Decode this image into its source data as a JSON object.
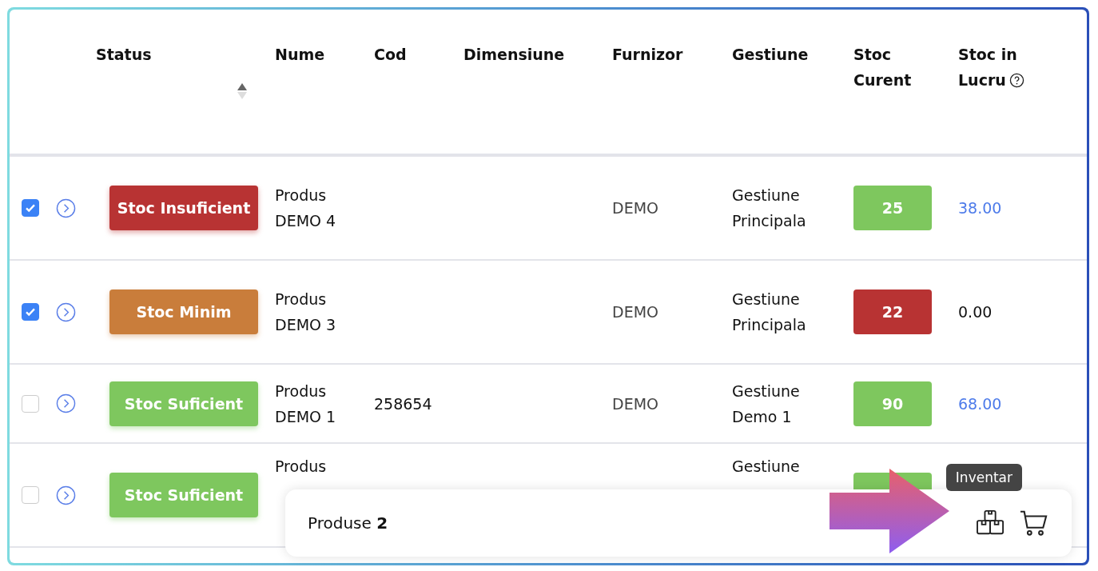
{
  "table": {
    "columns": [
      {
        "label": "Status",
        "sortable": true
      },
      {
        "label": "Nume"
      },
      {
        "label": "Cod"
      },
      {
        "label": "Dimensiune"
      },
      {
        "label": "Furnizor"
      },
      {
        "label": "Gestiune"
      },
      {
        "label": "Stoc Curent"
      },
      {
        "label": "Stoc in Lucru",
        "help": true
      }
    ],
    "rows": [
      {
        "checked": true,
        "status": {
          "label": "Stoc Insuficient",
          "color": "#b83333"
        },
        "name": "Produs DEMO 4",
        "furnizor": "DEMO",
        "gestiune": "Gestiune Principala",
        "stoc": {
          "value": "25",
          "color": "#7ec75e"
        },
        "lucru": {
          "value": "38.00",
          "linked": true
        }
      },
      {
        "checked": true,
        "status": {
          "label": "Stoc Minim",
          "color": "#c97d3b"
        },
        "name": "Produs DEMO 3",
        "furnizor": "DEMO",
        "gestiune": "Gestiune Principala",
        "stoc": {
          "value": "22",
          "color": "#b83333"
        },
        "lucru": {
          "value": "0.00",
          "linked": false
        }
      },
      {
        "checked": false,
        "status": {
          "label": "Stoc Suficient",
          "color": "#7ec75e"
        },
        "name": "Produs DEMO 1",
        "cod": "258654",
        "furnizor": "DEMO",
        "gestiune": "Gestiune Demo 1",
        "stoc": {
          "value": "90",
          "color": "#7ec75e"
        },
        "lucru": {
          "value": "68.00",
          "linked": true
        }
      },
      {
        "checked": false,
        "status": {
          "label": "Stoc Suficient",
          "color": "#7ec75e"
        },
        "name": "Produs",
        "gestiune": "Gestiune",
        "stoc": {
          "color": "#7ec75e"
        }
      }
    ]
  },
  "action_bar": {
    "count_text": "Produse **2**",
    "tooltip": "Inventar"
  }
}
